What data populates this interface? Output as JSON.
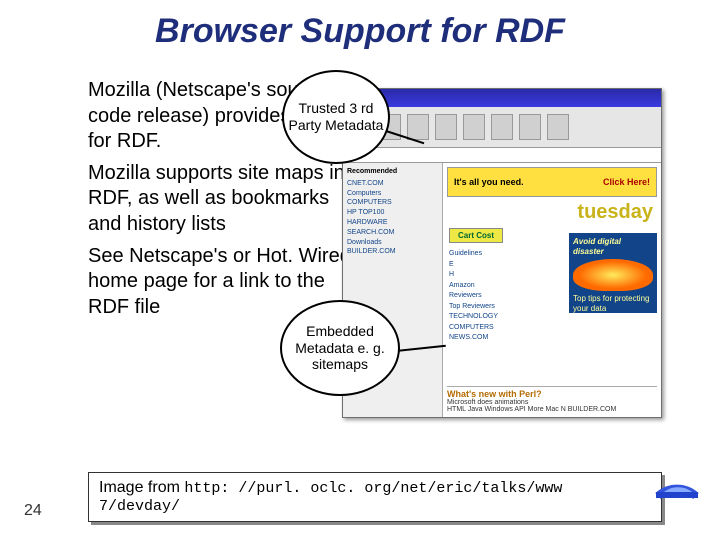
{
  "title": "Browser Support for RDF",
  "paragraphs": {
    "p1": "Mozilla (Netscape's source code release) provides support for RDF.",
    "p2": "Mozilla supports site maps in RDF, as well as bookmarks and history lists",
    "p3": "See Netscape's or Hot. Wired home page for a link to the RDF file"
  },
  "callouts": {
    "c1": "Trusted 3 rd Party Metadata",
    "c2": "Embedded Metadata e. g. sitemaps"
  },
  "screenshot": {
    "banner_left": "It's all you need.",
    "banner_right": "Click Here!",
    "day": "tuesday",
    "cart": "Cart Cost",
    "promo_top": "Avoid digital disaster",
    "promo_bottom": "Top tips for protecting your data",
    "sidebar_header": "Recommended",
    "sidebar_items": "CNET.COM\nComputers\nCOMPUTERS\nHP TOP100\nHARDWARE\nSEARCH.COM\nDownloads\nBUILDER.COM",
    "links": "Guidelines\nE\nH\nAmazon\nReviewers\nTop Reviewers\nTECHNOLOGY\nCOMPUTERS\nNEWS.COM",
    "story_head": "What's new with Perl?",
    "story_sub": "Microsoft does animations\nHTML Java Windows API More Mac N BUILDER.COM"
  },
  "caption": {
    "prefix": "Image from ",
    "url": "http: //purl. oclc. org/net/eric/talks/www 7/devday/"
  },
  "slide_number": "24"
}
